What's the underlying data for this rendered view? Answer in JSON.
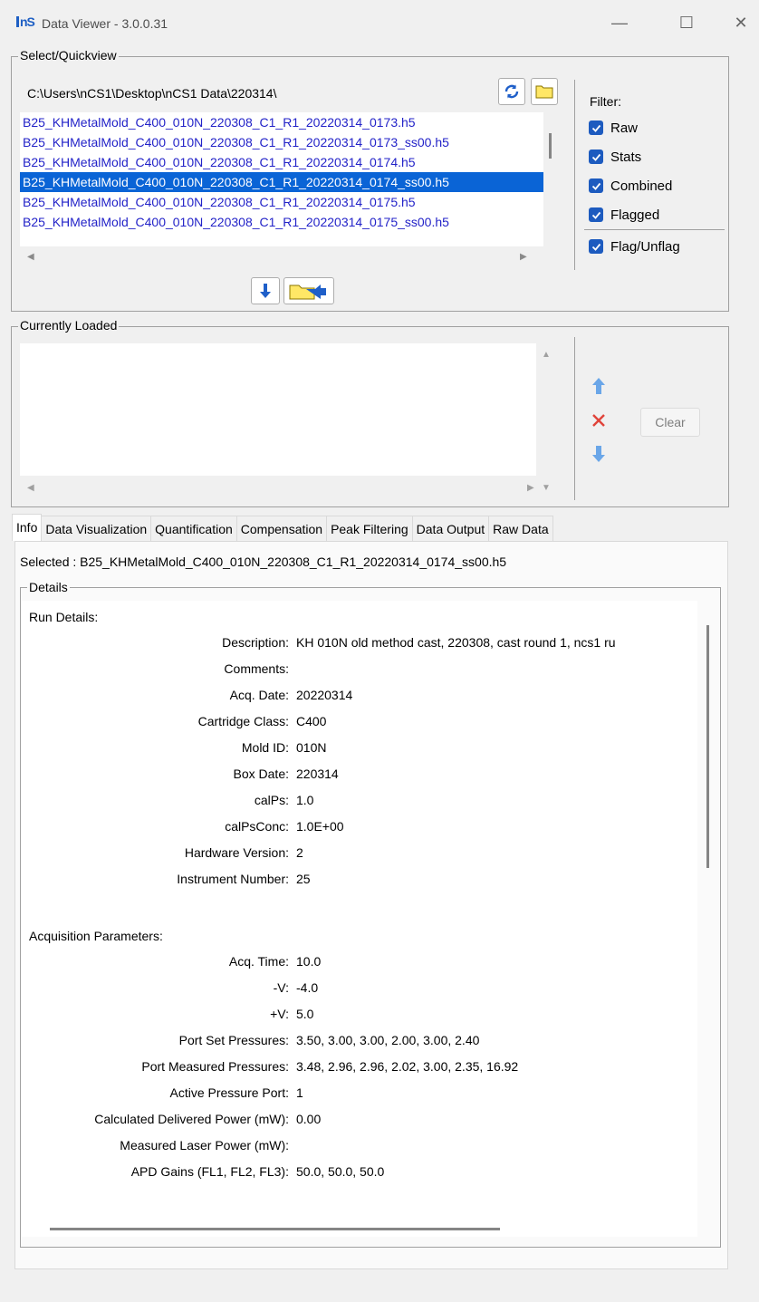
{
  "window": {
    "icon_text": "nS",
    "title": "Data Viewer - 3.0.0.31",
    "minimize": "—",
    "maximize": "☐",
    "close": "✕"
  },
  "quickview": {
    "group_label": "Select/Quickview",
    "path": "C:\\Users\\nCS1\\Desktop\\nCS1 Data\\220314\\",
    "files": [
      "B25_KHMetalMold_C400_010N_220308_C1_R1_20220314_0173.h5",
      "B25_KHMetalMold_C400_010N_220308_C1_R1_20220314_0173_ss00.h5",
      "B25_KHMetalMold_C400_010N_220308_C1_R1_20220314_0174.h5",
      "B25_KHMetalMold_C400_010N_220308_C1_R1_20220314_0174_ss00.h5",
      "B25_KHMetalMold_C400_010N_220308_C1_R1_20220314_0175.h5",
      "B25_KHMetalMold_C400_010N_220308_C1_R1_20220314_0175_ss00.h5"
    ],
    "selected_index": 3,
    "filter_label": "Filter:",
    "filters": [
      "Raw",
      "Stats",
      "Combined",
      "Flagged"
    ],
    "flag_unflag": "Flag/Unflag"
  },
  "loaded": {
    "group_label": "Currently Loaded",
    "clear": "Clear"
  },
  "tabs": [
    "Info",
    "Data Visualization",
    "Quantification",
    "Compensation",
    "Peak Filtering",
    "Data Output",
    "Raw Data"
  ],
  "info": {
    "selected": "Selected :  B25_KHMetalMold_C400_010N_220308_C1_R1_20220314_0174_ss00.h5",
    "details_label": "Details",
    "run_details_head": "Run Details:",
    "run_details": [
      {
        "k": "Description:",
        "v": "KH 010N old method cast, 220308, cast round 1, ncs1 ru"
      },
      {
        "k": "Comments:",
        "v": ""
      },
      {
        "k": "Acq. Date:",
        "v": "20220314"
      },
      {
        "k": "Cartridge Class:",
        "v": "C400"
      },
      {
        "k": "Mold ID:",
        "v": "010N"
      },
      {
        "k": "Box Date:",
        "v": "220314"
      },
      {
        "k": "calPs:",
        "v": "1.0"
      },
      {
        "k": "calPsConc:",
        "v": "1.0E+00"
      },
      {
        "k": "Hardware Version:",
        "v": "2"
      },
      {
        "k": "Instrument Number:",
        "v": "25"
      }
    ],
    "acq_head": "Acquisition Parameters:",
    "acq_params": [
      {
        "k": "Acq. Time:",
        "v": "10.0"
      },
      {
        "k": "-V:",
        "v": "-4.0"
      },
      {
        "k": "+V:",
        "v": "5.0"
      },
      {
        "k": "Port Set Pressures:",
        "v": "3.50, 3.00, 3.00, 2.00, 3.00, 2.40"
      },
      {
        "k": "Port Measured Pressures:",
        "v": "3.48, 2.96, 2.96, 2.02, 3.00, 2.35, 16.92"
      },
      {
        "k": "Active Pressure Port:",
        "v": "1"
      },
      {
        "k": "Calculated Delivered Power (mW):",
        "v": "0.00"
      },
      {
        "k": "Measured Laser Power (mW):",
        "v": ""
      },
      {
        "k": "APD Gains (FL1, FL2, FL3):",
        "v": "50.0, 50.0, 50.0"
      }
    ]
  }
}
